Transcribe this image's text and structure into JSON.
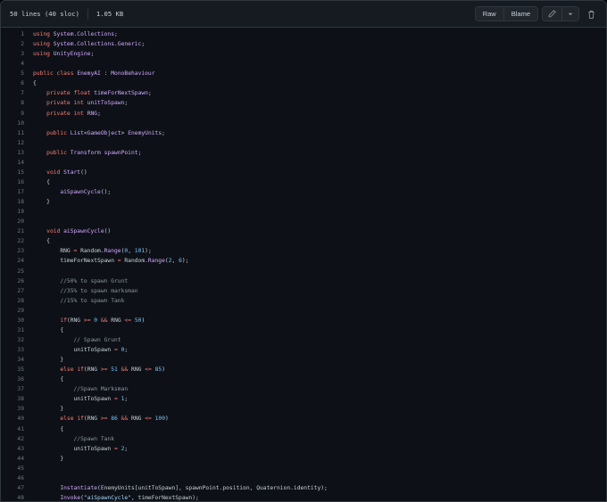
{
  "file_info": {
    "lines": "50 lines (40 sloc)",
    "size": "1.05 KB"
  },
  "toolbar": {
    "raw_label": "Raw",
    "blame_label": "Blame",
    "edit_icon": "pencil-icon",
    "menu_icon": "chevron-down-icon",
    "delete_icon": "trash-icon"
  },
  "colors": {
    "keyword": "#ff7b72",
    "type": "#d2a8ff",
    "number": "#79c0ff",
    "string": "#a5d6ff",
    "comment": "#8b949e",
    "text": "#c9d1d9",
    "background": "#0d1117"
  },
  "code_lines": [
    {
      "n": "1",
      "tokens": [
        [
          "kw",
          "using"
        ],
        [
          "id",
          " "
        ],
        [
          "ty",
          "System.Collections"
        ],
        [
          "id",
          ";"
        ]
      ]
    },
    {
      "n": "2",
      "tokens": [
        [
          "kw",
          "using"
        ],
        [
          "id",
          " "
        ],
        [
          "ty",
          "System.Collections.Generic"
        ],
        [
          "id",
          ";"
        ]
      ]
    },
    {
      "n": "3",
      "tokens": [
        [
          "kw",
          "using"
        ],
        [
          "id",
          " "
        ],
        [
          "ty",
          "UnityEngine"
        ],
        [
          "id",
          ";"
        ]
      ]
    },
    {
      "n": "4",
      "tokens": []
    },
    {
      "n": "5",
      "tokens": [
        [
          "kw",
          "public"
        ],
        [
          "id",
          " "
        ],
        [
          "kw",
          "class"
        ],
        [
          "id",
          " "
        ],
        [
          "ty",
          "EnemyAI"
        ],
        [
          "id",
          " : "
        ],
        [
          "ty",
          "MonoBehaviour"
        ]
      ]
    },
    {
      "n": "6",
      "tokens": [
        [
          "id",
          "{"
        ]
      ]
    },
    {
      "n": "7",
      "tokens": [
        [
          "id",
          "    "
        ],
        [
          "kw",
          "private"
        ],
        [
          "id",
          " "
        ],
        [
          "kw",
          "float"
        ],
        [
          "id",
          " "
        ],
        [
          "ty",
          "timeForNextSpawn"
        ],
        [
          "id",
          ";"
        ]
      ]
    },
    {
      "n": "8",
      "tokens": [
        [
          "id",
          "    "
        ],
        [
          "kw",
          "private"
        ],
        [
          "id",
          " "
        ],
        [
          "kw",
          "int"
        ],
        [
          "id",
          " "
        ],
        [
          "ty",
          "unitToSpawn"
        ],
        [
          "id",
          ";"
        ]
      ]
    },
    {
      "n": "9",
      "tokens": [
        [
          "id",
          "    "
        ],
        [
          "kw",
          "private"
        ],
        [
          "id",
          " "
        ],
        [
          "kw",
          "int"
        ],
        [
          "id",
          " "
        ],
        [
          "ty",
          "RNG"
        ],
        [
          "id",
          ";"
        ]
      ]
    },
    {
      "n": "10",
      "tokens": []
    },
    {
      "n": "11",
      "tokens": [
        [
          "id",
          "    "
        ],
        [
          "kw",
          "public"
        ],
        [
          "id",
          " "
        ],
        [
          "ty",
          "List"
        ],
        [
          "id",
          "<"
        ],
        [
          "ty",
          "GameObject"
        ],
        [
          "id",
          "> "
        ],
        [
          "ty",
          "EnemyUnits"
        ],
        [
          "id",
          ";"
        ]
      ]
    },
    {
      "n": "12",
      "tokens": []
    },
    {
      "n": "13",
      "tokens": [
        [
          "id",
          "    "
        ],
        [
          "kw",
          "public"
        ],
        [
          "id",
          " "
        ],
        [
          "ty",
          "Transform"
        ],
        [
          "id",
          " "
        ],
        [
          "ty",
          "spawnPoint"
        ],
        [
          "id",
          ";"
        ]
      ]
    },
    {
      "n": "14",
      "tokens": []
    },
    {
      "n": "15",
      "tokens": [
        [
          "id",
          "    "
        ],
        [
          "kw",
          "void"
        ],
        [
          "id",
          " "
        ],
        [
          "ty",
          "Start"
        ],
        [
          "id",
          "()"
        ]
      ]
    },
    {
      "n": "16",
      "tokens": [
        [
          "id",
          "    {"
        ]
      ]
    },
    {
      "n": "17",
      "tokens": [
        [
          "id",
          "        "
        ],
        [
          "ty",
          "aiSpawnCycle"
        ],
        [
          "id",
          "();"
        ]
      ]
    },
    {
      "n": "18",
      "tokens": [
        [
          "id",
          "    }"
        ]
      ]
    },
    {
      "n": "19",
      "tokens": []
    },
    {
      "n": "20",
      "tokens": []
    },
    {
      "n": "21",
      "tokens": [
        [
          "id",
          "    "
        ],
        [
          "kw",
          "void"
        ],
        [
          "id",
          " "
        ],
        [
          "ty",
          "aiSpawnCycle"
        ],
        [
          "id",
          "()"
        ]
      ]
    },
    {
      "n": "22",
      "tokens": [
        [
          "id",
          "    {"
        ]
      ]
    },
    {
      "n": "23",
      "tokens": [
        [
          "id",
          "        RNG "
        ],
        [
          "kw",
          "="
        ],
        [
          "id",
          " Random."
        ],
        [
          "ty",
          "Range"
        ],
        [
          "id",
          "("
        ],
        [
          "num",
          "0"
        ],
        [
          "id",
          ", "
        ],
        [
          "num",
          "101"
        ],
        [
          "id",
          ");"
        ]
      ]
    },
    {
      "n": "24",
      "tokens": [
        [
          "id",
          "        timeForNextSpawn "
        ],
        [
          "kw",
          "="
        ],
        [
          "id",
          " Random."
        ],
        [
          "ty",
          "Range"
        ],
        [
          "id",
          "("
        ],
        [
          "num",
          "2"
        ],
        [
          "id",
          ", "
        ],
        [
          "num",
          "6"
        ],
        [
          "id",
          ");"
        ]
      ]
    },
    {
      "n": "25",
      "tokens": []
    },
    {
      "n": "26",
      "tokens": [
        [
          "id",
          "        "
        ],
        [
          "cm",
          "//50% to spawn Grunt"
        ]
      ]
    },
    {
      "n": "27",
      "tokens": [
        [
          "id",
          "        "
        ],
        [
          "cm",
          "//35% to spawn marksman"
        ]
      ]
    },
    {
      "n": "28",
      "tokens": [
        [
          "id",
          "        "
        ],
        [
          "cm",
          "//15% to spawn Tank"
        ]
      ]
    },
    {
      "n": "29",
      "tokens": []
    },
    {
      "n": "30",
      "tokens": [
        [
          "id",
          "        "
        ],
        [
          "kw",
          "if"
        ],
        [
          "id",
          "(RNG "
        ],
        [
          "kw",
          ">="
        ],
        [
          "id",
          " "
        ],
        [
          "num",
          "0"
        ],
        [
          "id",
          " "
        ],
        [
          "kw",
          "&&"
        ],
        [
          "id",
          " RNG "
        ],
        [
          "kw",
          "<="
        ],
        [
          "id",
          " "
        ],
        [
          "num",
          "50"
        ],
        [
          "id",
          ")"
        ]
      ]
    },
    {
      "n": "31",
      "tokens": [
        [
          "id",
          "        {"
        ]
      ]
    },
    {
      "n": "32",
      "tokens": [
        [
          "id",
          "            "
        ],
        [
          "cm",
          "// Spawn Grunt"
        ]
      ]
    },
    {
      "n": "33",
      "tokens": [
        [
          "id",
          "            unitToSpawn "
        ],
        [
          "kw",
          "="
        ],
        [
          "id",
          " "
        ],
        [
          "num",
          "0"
        ],
        [
          "id",
          ";"
        ]
      ]
    },
    {
      "n": "34",
      "tokens": [
        [
          "id",
          "        }"
        ]
      ]
    },
    {
      "n": "35",
      "tokens": [
        [
          "id",
          "        "
        ],
        [
          "kw",
          "else"
        ],
        [
          "id",
          " "
        ],
        [
          "kw",
          "if"
        ],
        [
          "id",
          "(RNG "
        ],
        [
          "kw",
          ">="
        ],
        [
          "id",
          " "
        ],
        [
          "num",
          "51"
        ],
        [
          "id",
          " "
        ],
        [
          "kw",
          "&&"
        ],
        [
          "id",
          " RNG "
        ],
        [
          "kw",
          "<="
        ],
        [
          "id",
          " "
        ],
        [
          "num",
          "85"
        ],
        [
          "id",
          ")"
        ]
      ]
    },
    {
      "n": "36",
      "tokens": [
        [
          "id",
          "        {"
        ]
      ]
    },
    {
      "n": "37",
      "tokens": [
        [
          "id",
          "            "
        ],
        [
          "cm",
          "//Spawn Marksman"
        ]
      ]
    },
    {
      "n": "38",
      "tokens": [
        [
          "id",
          "            unitToSpawn "
        ],
        [
          "kw",
          "="
        ],
        [
          "id",
          " "
        ],
        [
          "num",
          "1"
        ],
        [
          "id",
          ";"
        ]
      ]
    },
    {
      "n": "39",
      "tokens": [
        [
          "id",
          "        }"
        ]
      ]
    },
    {
      "n": "40",
      "tokens": [
        [
          "id",
          "        "
        ],
        [
          "kw",
          "else"
        ],
        [
          "id",
          " "
        ],
        [
          "kw",
          "if"
        ],
        [
          "id",
          "(RNG "
        ],
        [
          "kw",
          ">="
        ],
        [
          "id",
          " "
        ],
        [
          "num",
          "86"
        ],
        [
          "id",
          " "
        ],
        [
          "kw",
          "&&"
        ],
        [
          "id",
          " RNG "
        ],
        [
          "kw",
          "<="
        ],
        [
          "id",
          " "
        ],
        [
          "num",
          "100"
        ],
        [
          "id",
          ")"
        ]
      ]
    },
    {
      "n": "41",
      "tokens": [
        [
          "id",
          "        {"
        ]
      ]
    },
    {
      "n": "42",
      "tokens": [
        [
          "id",
          "            "
        ],
        [
          "cm",
          "//Spawn Tank"
        ]
      ]
    },
    {
      "n": "43",
      "tokens": [
        [
          "id",
          "            unitToSpawn "
        ],
        [
          "kw",
          "="
        ],
        [
          "id",
          " "
        ],
        [
          "num",
          "2"
        ],
        [
          "id",
          ";"
        ]
      ]
    },
    {
      "n": "44",
      "tokens": [
        [
          "id",
          "        }"
        ]
      ]
    },
    {
      "n": "45",
      "tokens": []
    },
    {
      "n": "46",
      "tokens": []
    },
    {
      "n": "47",
      "tokens": [
        [
          "id",
          "        "
        ],
        [
          "ty",
          "Instantiate"
        ],
        [
          "id",
          "(EnemyUnits[unitToSpawn], spawnPoint.position, Quaternion.identity);"
        ]
      ]
    },
    {
      "n": "48",
      "tokens": [
        [
          "id",
          "        "
        ],
        [
          "ty",
          "Invoke"
        ],
        [
          "id",
          "("
        ],
        [
          "str",
          "\"aiSpawnCycle\""
        ],
        [
          "id",
          ", timeForNextSpawn);"
        ]
      ]
    }
  ]
}
